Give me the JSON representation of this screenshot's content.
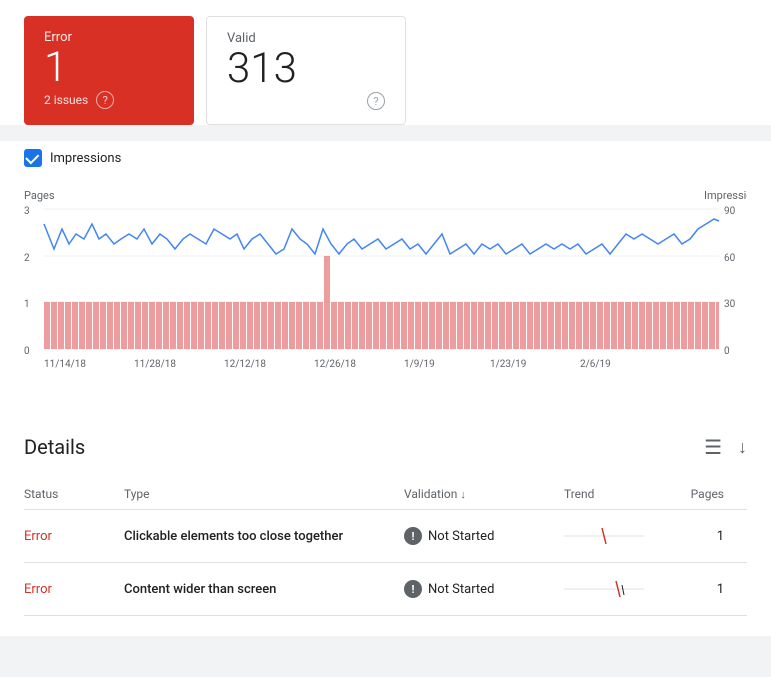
{
  "status_cards": {
    "error": {
      "label": "Error",
      "number": "1",
      "issues": "2 issues",
      "help": "?"
    },
    "valid": {
      "label": "Valid",
      "number": "313",
      "help": "?"
    }
  },
  "chart": {
    "impressions_label": "Impressions",
    "y_left_label": "Pages",
    "y_right_label": "Impressions",
    "x_labels": [
      "11/14/18",
      "11/28/18",
      "12/12/18",
      "12/26/18",
      "1/9/19",
      "1/23/19",
      "2/6/19"
    ],
    "y_left_values": [
      "3",
      "2",
      "1",
      "0"
    ],
    "y_right_values": [
      "90",
      "60",
      "30",
      "0"
    ]
  },
  "details": {
    "title": "Details",
    "filter_icon": "≡",
    "download_icon": "⬇",
    "columns": {
      "status": "Status",
      "type": "Type",
      "validation": "Validation",
      "trend": "Trend",
      "pages": "Pages"
    },
    "rows": [
      {
        "status": "Error",
        "type": "Clickable elements too close together",
        "validation": "Not Started",
        "pages": "1"
      },
      {
        "status": "Error",
        "type": "Content wider than screen",
        "validation": "Not Started",
        "pages": "1"
      }
    ]
  }
}
